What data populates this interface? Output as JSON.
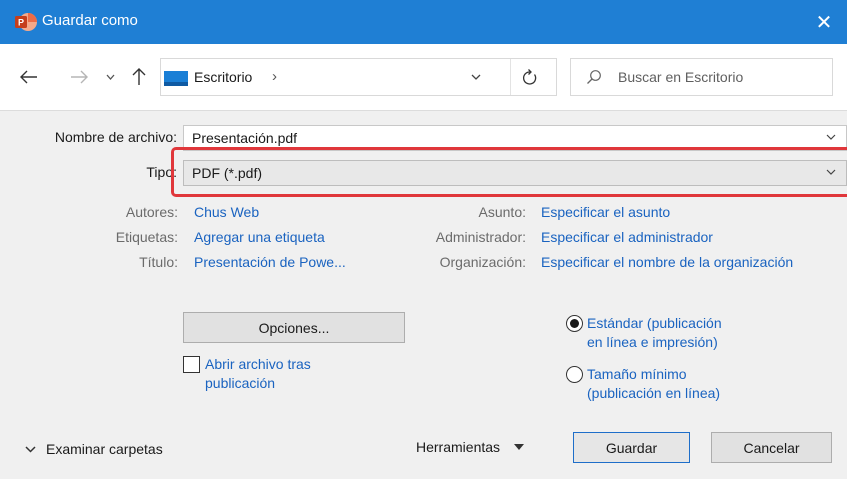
{
  "window": {
    "title": "Guardar como",
    "app_icon_letter": "P",
    "close_glyph": "✕"
  },
  "nav": {
    "back_glyph": "←",
    "forward_glyph": "→",
    "recent_glyph": "⌄",
    "up_glyph": "↑",
    "address_path": "Escritorio",
    "address_sep": "›",
    "address_dropdown": "⌄",
    "search_placeholder": "Buscar en Escritorio"
  },
  "form": {
    "filename_label": "Nombre de archivo:",
    "filename_value": "Presentación.pdf",
    "type_label": "Tipo:",
    "type_value": "PDF (*.pdf)"
  },
  "metadata": {
    "authors_label": "Autores:",
    "authors_value": "Chus Web",
    "tags_label": "Etiquetas:",
    "tags_value": "Agregar una etiqueta",
    "title_label": "Título:",
    "title_value": "Presentación de Powe...",
    "subject_label": "Asunto:",
    "subject_value": "Especificar el asunto",
    "manager_label": "Administrador:",
    "manager_value": "Especificar el administrador",
    "org_label": "Organización:",
    "org_value": "Especificar el nombre de la organización"
  },
  "options": {
    "options_button": "Opciones...",
    "open_after_line1": "Abrir archivo tras",
    "open_after_line2": "publicación",
    "open_after_checked": false,
    "standard_line1": "Estándar (publicación",
    "standard_line2": "en línea e impresión)",
    "minimum_line1": "Tamaño mínimo",
    "minimum_line2": "(publicación en línea)",
    "selected_option": "standard"
  },
  "footer": {
    "browse_folders": "Examinar carpetas",
    "tools": "Herramientas",
    "save": "Guardar",
    "cancel": "Cancelar"
  },
  "colors": {
    "titlebar": "#1f7fd4",
    "link": "#1a63c0",
    "highlight": "#e0373b",
    "dialog_bg": "#f0f0f0"
  }
}
